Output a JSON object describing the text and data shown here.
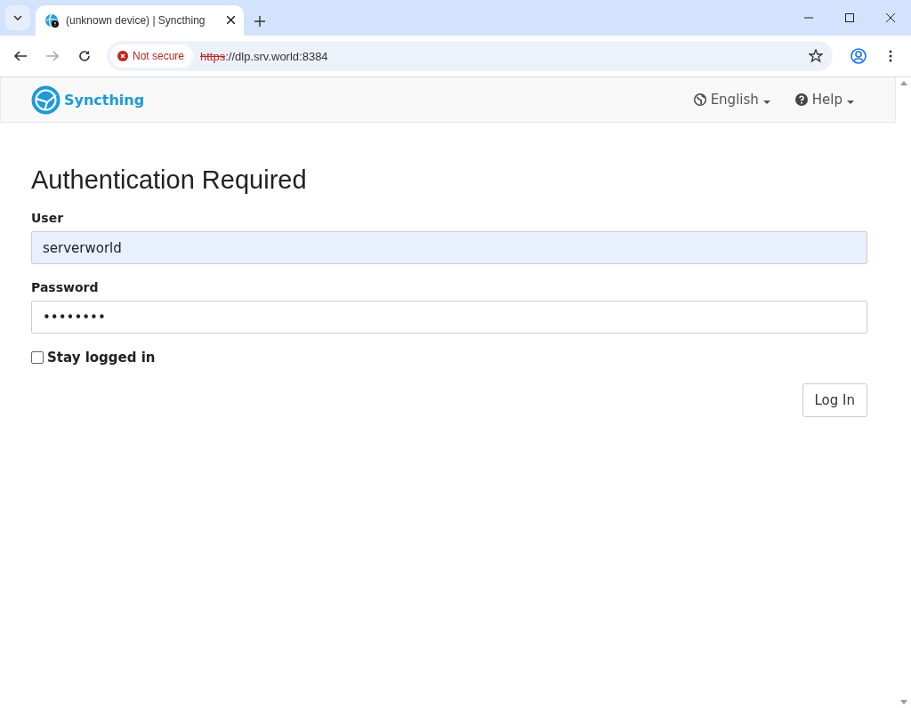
{
  "browser": {
    "tabs": [
      {
        "title": "(unknown device) | Syncthing",
        "selected": true
      }
    ],
    "security_chip": "Not secure",
    "url_scheme": "https",
    "url_rest": "://dlp.srv.world:8384"
  },
  "navbar": {
    "brand": "Syncthing",
    "menus": [
      {
        "kind": "language",
        "label": "English"
      },
      {
        "kind": "help",
        "label": "Help"
      }
    ]
  },
  "form": {
    "title": "Authentication Required",
    "fields": [
      {
        "label": "User",
        "value": "serverworld",
        "autofilled": true
      },
      {
        "label": "Password",
        "value": "••••••••",
        "autofilled": false
      }
    ],
    "stay_logged_in": {
      "label": "Stay logged in",
      "checked": false
    },
    "submit": "Log In"
  }
}
